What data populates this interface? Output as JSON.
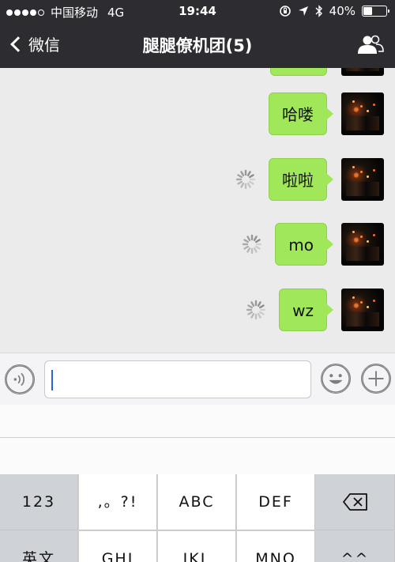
{
  "status_bar": {
    "carrier": "中国移动",
    "network": "4G",
    "time": "19:44",
    "battery": "40%",
    "battery_level": 0.4
  },
  "nav": {
    "back_label": "微信",
    "title": "腿腿僚机团(5)",
    "right_icon": "group-members-icon"
  },
  "messages": [
    {
      "text": "哈喽",
      "status": "sent"
    },
    {
      "text": "啦啦",
      "status": "sending"
    },
    {
      "text": "mo",
      "status": "sending"
    },
    {
      "text": "wz",
      "status": "sending"
    }
  ],
  "input": {
    "value": "",
    "left_icon": "voice-icon",
    "emoji_icon": "emoji-icon",
    "plus_icon": "plus-icon"
  },
  "keyboard": {
    "row1": [
      "123",
      ",。?!",
      "ABC",
      "DEF",
      "delete-icon"
    ],
    "row2": [
      "英文",
      "GHI",
      "JKL",
      "MNO",
      "^^"
    ]
  },
  "colors": {
    "nav_bg": "#2d2c30",
    "bubble": "#a0e75a",
    "chat_bg": "#ebebeb",
    "caret": "#2a64d8"
  }
}
